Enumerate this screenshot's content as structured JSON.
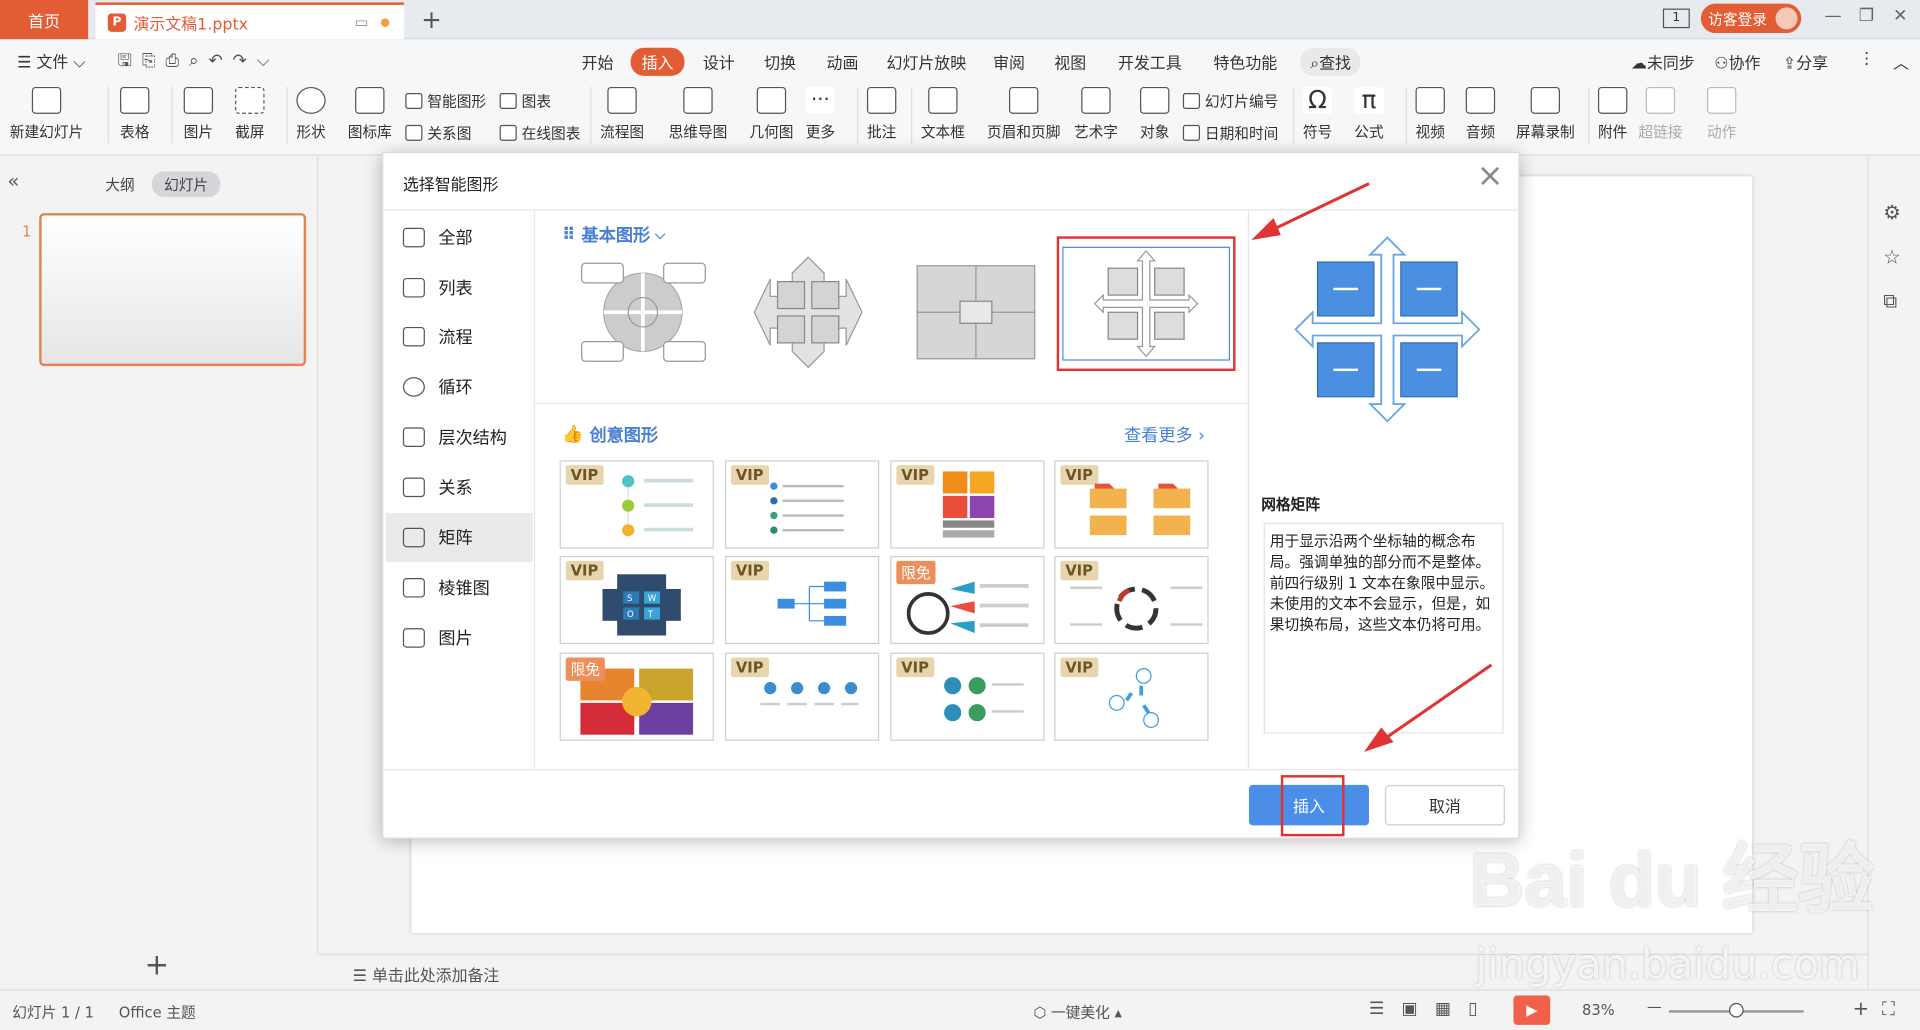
{
  "tabs": {
    "home": "首页",
    "doc": "演示文稿1.pptx",
    "guest": "访客登录"
  },
  "menu": {
    "file": "文件",
    "items": [
      "开始",
      "插入",
      "设计",
      "切换",
      "动画",
      "幻灯片放映",
      "审阅",
      "视图",
      "开发工具",
      "特色功能"
    ],
    "active": "插入",
    "search": "查找",
    "sync": "未同步",
    "collab": "协作",
    "share": "分享"
  },
  "ribbon": {
    "large": [
      "新建幻灯片",
      "表格",
      "图片",
      "截屏",
      "形状",
      "图标库",
      "流程图",
      "思维导图",
      "几何图",
      "更多",
      "批注",
      "文本框",
      "页眉和页脚",
      "艺术字",
      "对象",
      "符号",
      "公式",
      "视频",
      "音频",
      "屏幕录制",
      "附件",
      "超链接",
      "动作"
    ],
    "small": [
      "智能图形",
      "图表",
      "关系图",
      "在线图表",
      "幻灯片编号",
      "日期和时间"
    ]
  },
  "leftpanel": {
    "outline": "大纲",
    "slides": "幻灯片",
    "slide_num": "1"
  },
  "dialog": {
    "title": "选择智能图形",
    "categories": [
      "全部",
      "列表",
      "流程",
      "循环",
      "层次结构",
      "关系",
      "矩阵",
      "棱锥图",
      "图片"
    ],
    "selected_category": "矩阵",
    "basic_section": "基本图形",
    "creative_section": "创意图形",
    "see_more": "查看更多",
    "badges": [
      "VIP",
      "VIP",
      "VIP",
      "VIP",
      "VIP",
      "VIP",
      "限免",
      "VIP",
      "限免",
      "VIP",
      "VIP",
      "VIP"
    ],
    "swot": [
      "S",
      "W",
      "O",
      "T"
    ],
    "desc_title": "网格矩阵",
    "desc_text": "用于显示沿两个坐标轴的概念布局。强调单独的部分而不是整体。前四行级别 1 文本在象限中显示。未使用的文本不会显示，但是，如果切换布局，这些文本仍将可用。",
    "insert": "插入",
    "cancel": "取消"
  },
  "notes": "单击此处添加备注",
  "status": {
    "slide": "幻灯片 1 / 1",
    "theme": "Office 主题",
    "beautify": "一键美化",
    "zoom": "83%"
  },
  "watermark": {
    "logo": "Bai du 经验",
    "url": "jingyan.baidu.com"
  }
}
